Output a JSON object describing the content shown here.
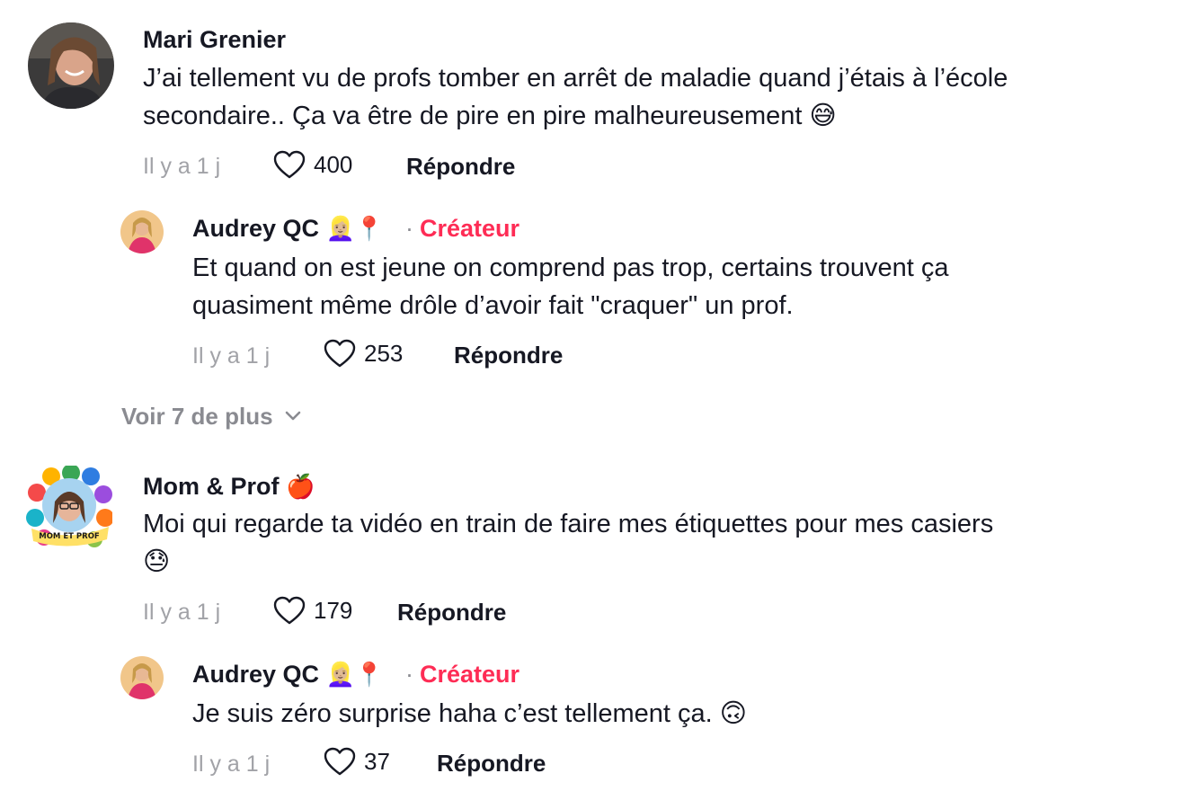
{
  "comments": [
    {
      "username": "Mari Grenier",
      "text_line1": "J’ai tellement vu de profs tomber en arrêt de maladie quand j’étais à l’école",
      "text_line2": "secondaire.. Ça va être de pire en pire malheureusement 😅",
      "time": "Il y a 1 j",
      "likes": "400",
      "reply_label": "Répondre",
      "replies": [
        {
          "username": "Audrey QC",
          "username_emojis": "👱🏼‍♀️📍",
          "separator": "·",
          "creator_label": "Créateur",
          "text_line1": "Et quand on est jeune on comprend pas trop, certains trouvent ça",
          "text_line2": "quasiment même drôle d’avoir fait \"craquer\" un prof.",
          "time": "Il y a 1 j",
          "likes": "253",
          "reply_label": "Répondre"
        }
      ],
      "more_replies_label": "Voir 7 de plus"
    },
    {
      "username": "Mom & Prof",
      "username_emojis": "🍎",
      "text_line1": "Moi qui regarde ta vidéo en train de faire mes étiquettes pour mes casiers",
      "text_line2": "😓",
      "avatar_text": "MOM ET PROF",
      "time": "Il y a 1 j",
      "likes": "179",
      "reply_label": "Répondre",
      "replies": [
        {
          "username": "Audrey QC",
          "username_emojis": "👱🏼‍♀️📍",
          "separator": "·",
          "creator_label": "Créateur",
          "text_line1": "Je suis zéro surprise haha c’est tellement ça. 🙃",
          "time": "Il y a 1 j",
          "likes": "37",
          "reply_label": "Répondre"
        }
      ]
    }
  ],
  "colors": {
    "creator": "#fe2c55",
    "muted": "#a1a2a7",
    "text": "#161823"
  },
  "icons": {
    "like": "heart-outline-icon",
    "expand": "chevron-down-icon"
  }
}
